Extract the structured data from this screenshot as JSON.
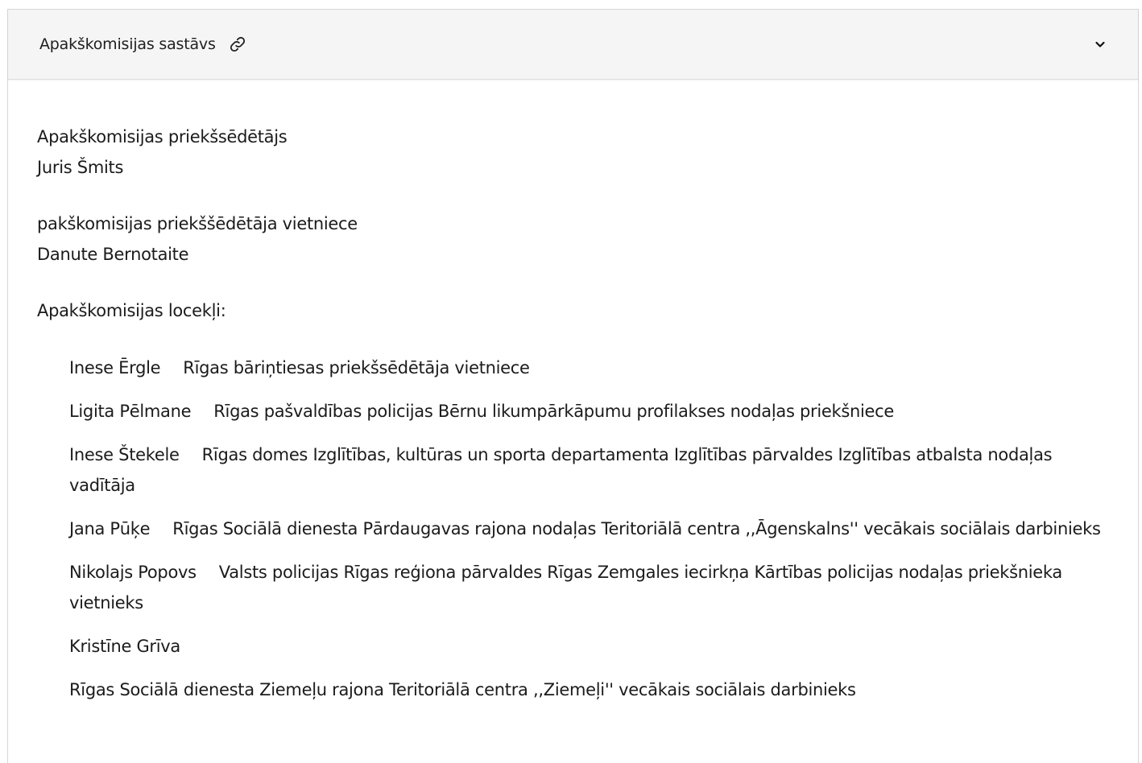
{
  "accordion": {
    "title": "Apakškomisijas sastāvs",
    "link_icon": "link-icon",
    "toggle_icon": "chevron-down-icon",
    "expanded": true
  },
  "content": {
    "chair": {
      "role": "Apakškomisijas priekšsēdētājs",
      "name": "Juris Šmits"
    },
    "vice_chair": {
      "role": "pakškomisijas priekššēdētāja vietniece",
      "name": "Danute Bernotaite"
    },
    "members_heading": "Apakškomisijas locekļi:",
    "members": [
      {
        "name": "Inese Ērgle",
        "position": "Rīgas bāriņtiesas priekšsēdētāja vietniece"
      },
      {
        "name": "Ligita Pēlmane",
        "position": "Rīgas pašvaldības policijas Bērnu likumpārkāpumu profilakses nodaļas priekšniece"
      },
      {
        "name": "Inese Štekele",
        "position": "Rīgas domes Izglītības, kultūras un sporta departamenta Izglītības pārvaldes Izglītības atbalsta nodaļas vadītāja"
      },
      {
        "name": "Jana Pūķe",
        "position": "Rīgas Sociālā dienesta Pārdaugavas rajona nodaļas Teritoriālā centra ,,Āgenskalns'' vecākais sociālais darbinieks"
      },
      {
        "name": "Nikolajs Popovs",
        "position": "Valsts policijas Rīgas reģiona pārvaldes Rīgas Zemgales iecirkņa Kārtības policijas nodaļas priekšnieka vietnieks"
      },
      {
        "name": "Kristīne Grīva",
        "position": ""
      },
      {
        "name": "",
        "position": "Rīgas Sociālā dienesta Ziemeļu rajona Teritoriālā centra ,,Ziemeļi'' vecākais sociālais darbinieks"
      }
    ]
  }
}
